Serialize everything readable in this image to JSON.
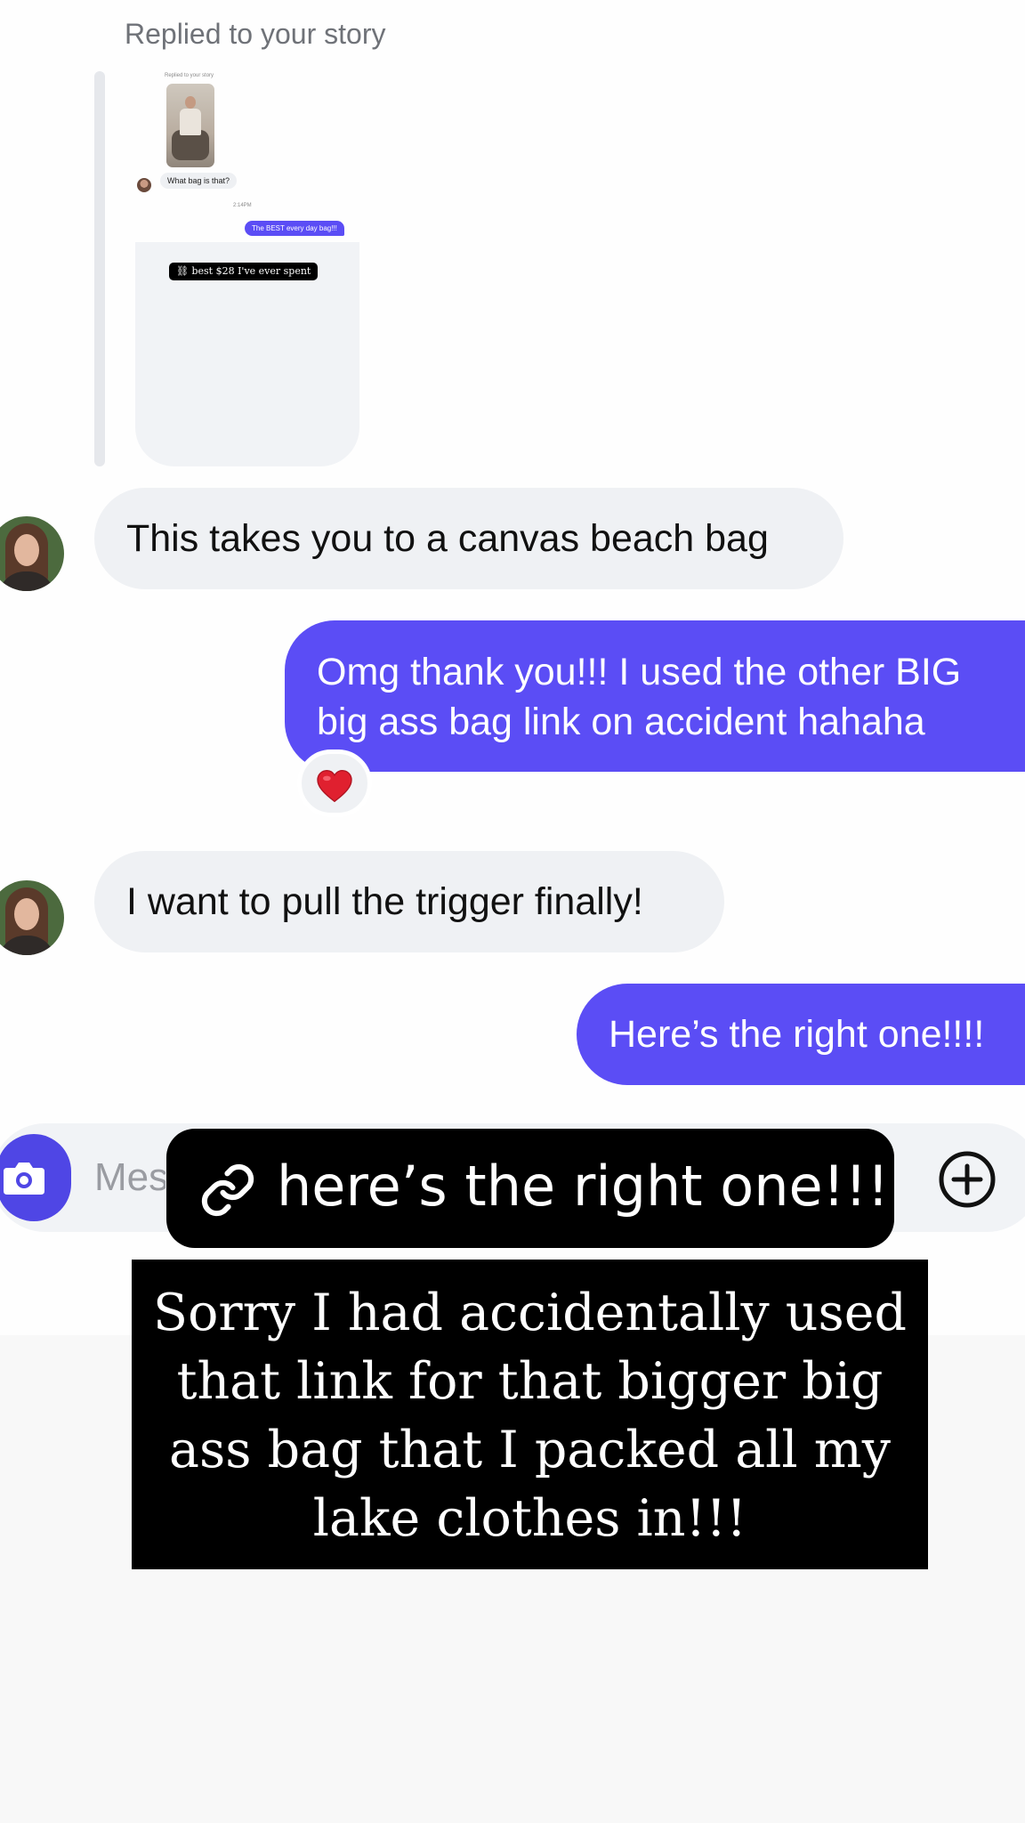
{
  "thread": {
    "reply_header": "Replied to your story",
    "story_preview": {
      "header": "Replied to your story",
      "message": "What bag is that?",
      "time": "2:14PM",
      "reply": "The BEST every day bag!!!",
      "sticker": "best $28 I've ever spent"
    },
    "messages": [
      {
        "from": "them",
        "text": "This takes you to a canvas beach bag"
      },
      {
        "from": "me",
        "lines": [
          "Omg thank you!!! I used the other BIG",
          "big ass bag link on accident hahaha"
        ],
        "reaction": "heart"
      },
      {
        "from": "them",
        "text": "I want to pull the trigger finally!"
      },
      {
        "from": "me",
        "text": "Here’s the right one!!!!"
      }
    ]
  },
  "composer": {
    "placeholder": "Mes"
  },
  "overlay": {
    "link_sticker": "here’s the right one!!!",
    "caption_lines": [
      "Sorry I had accidentally used",
      "that link for that bigger big",
      "ass bag that I packed all my",
      "lake clothes in!!!"
    ]
  },
  "colors": {
    "accent": "#5b4df5",
    "camera": "#4f46e5",
    "incoming_bubble": "#eff1f4",
    "heart": "#e0202f"
  },
  "icons": {
    "link": "link-icon",
    "camera": "camera-icon",
    "plus": "plus-circle-icon",
    "reaction": "heart-icon"
  }
}
